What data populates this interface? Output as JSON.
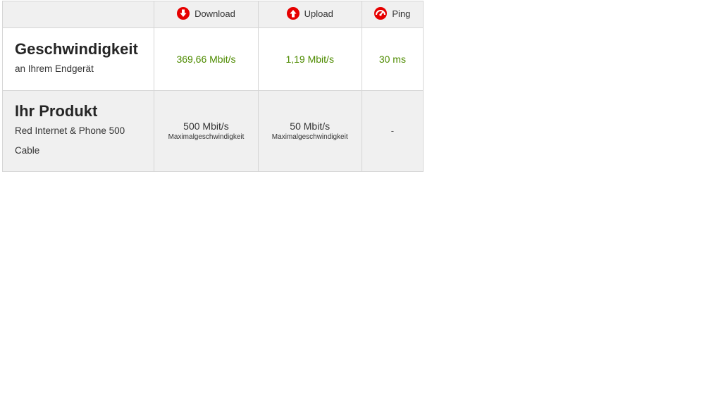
{
  "header": {
    "download_label": "Download",
    "upload_label": "Upload",
    "ping_label": "Ping"
  },
  "speed_row": {
    "title": "Geschwindigkeit",
    "subtitle": "an Ihrem Endgerät",
    "download": "369,66 Mbit/s",
    "upload": "1,19 Mbit/s",
    "ping": "30 ms"
  },
  "product_row": {
    "title": "Ihr Produkt",
    "product_line1": "Red Internet & Phone 500",
    "product_line2": "Cable",
    "download": "500 Mbit/s",
    "download_caption": "Maximalgeschwindigkeit",
    "upload": "50 Mbit/s",
    "upload_caption": "Maximalgeschwindigkeit",
    "ping": "-"
  },
  "icons": {
    "download": "download-arrow-icon",
    "upload": "upload-arrow-icon",
    "ping": "ping-gauge-icon"
  },
  "colors": {
    "brand_red": "#e60000",
    "value_green": "#4e8b00",
    "header_bg": "#f0f0f0",
    "border": "#d6d6d6"
  }
}
